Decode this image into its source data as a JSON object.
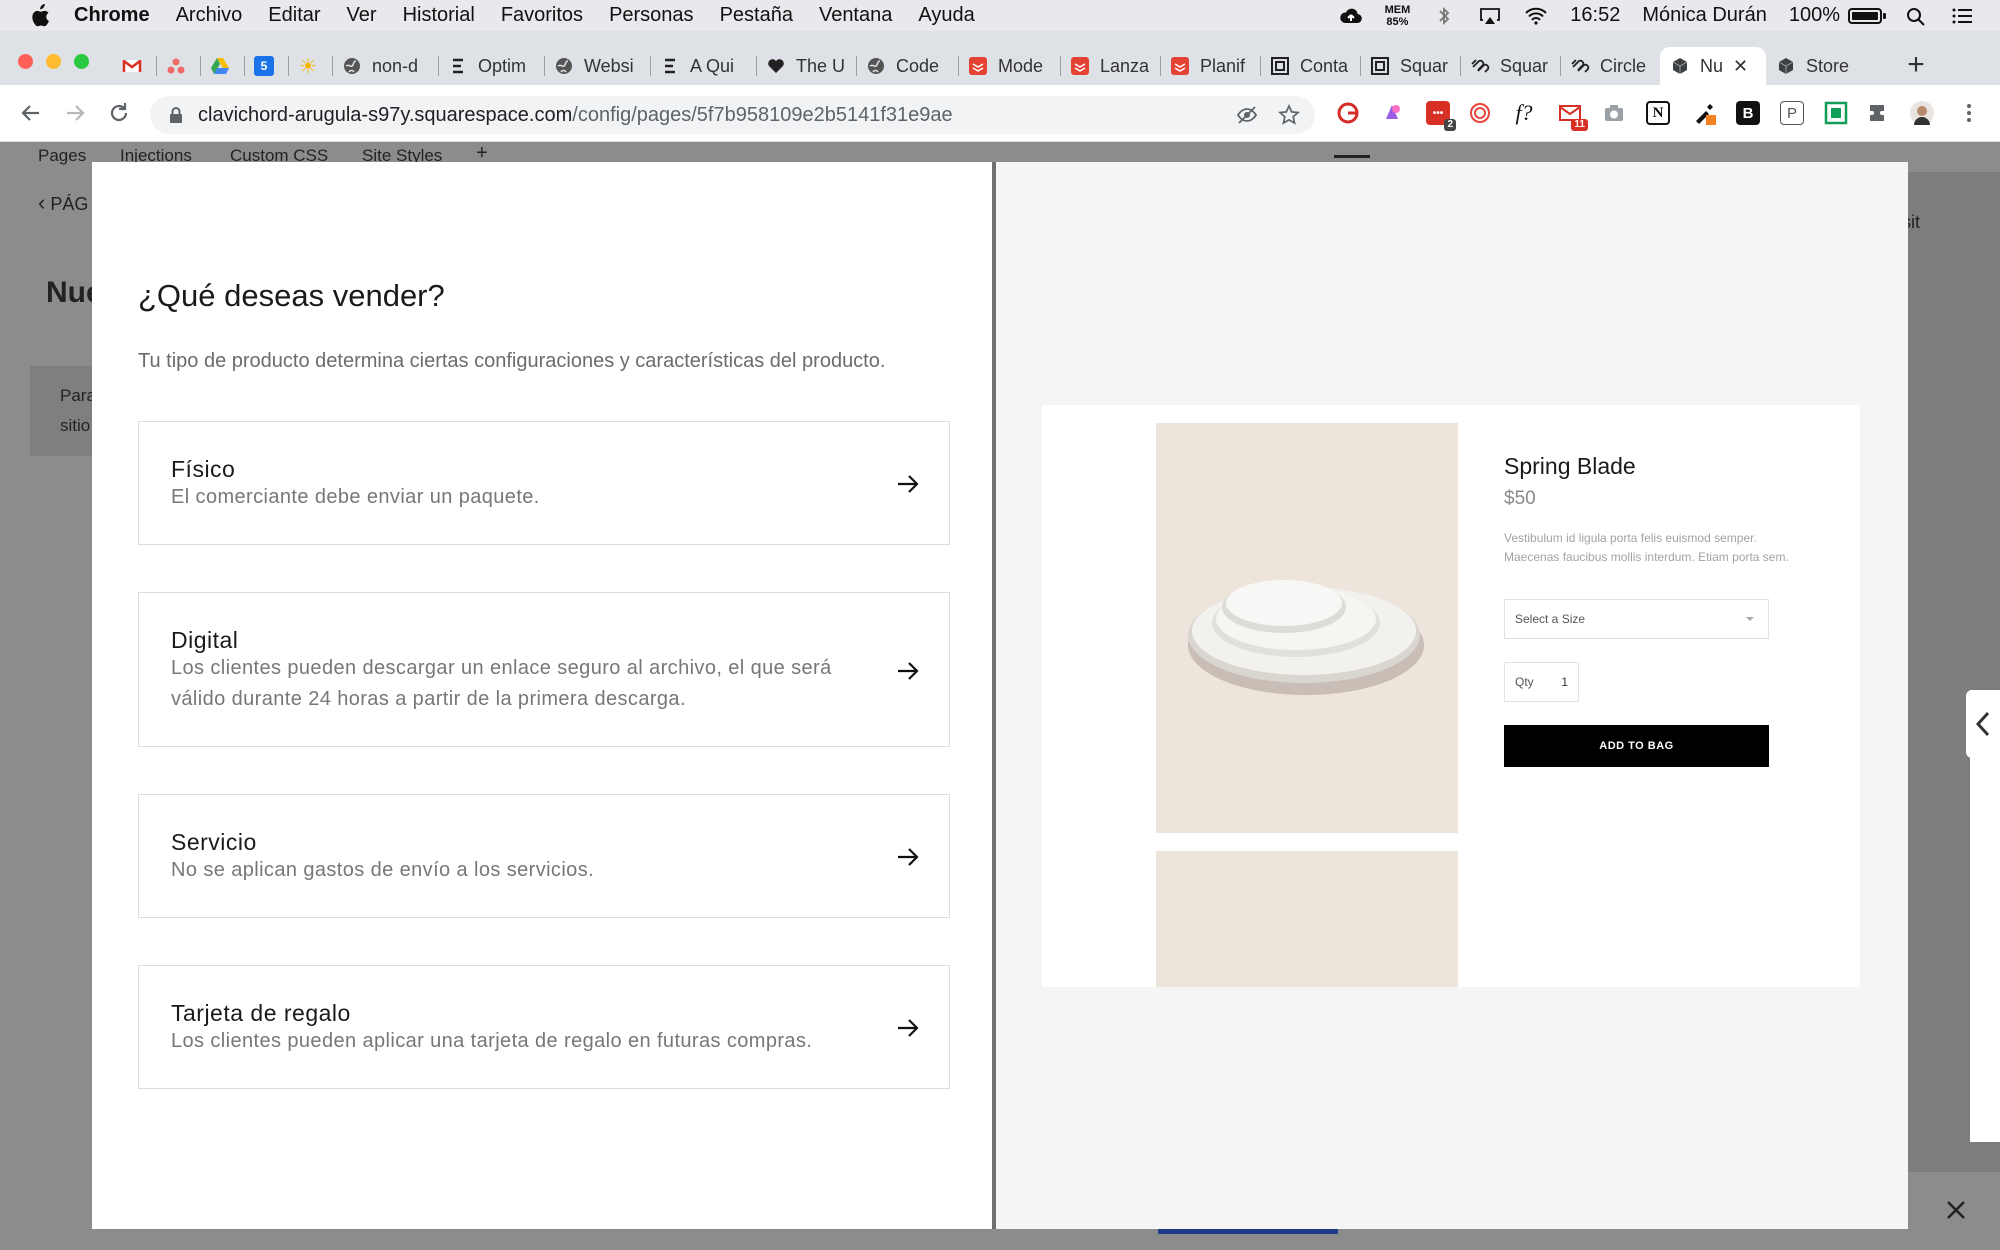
{
  "menubar": {
    "app": "Chrome",
    "items": [
      "Archivo",
      "Editar",
      "Ver",
      "Historial",
      "Favoritos",
      "Personas",
      "Pestaña",
      "Ventana",
      "Ayuda"
    ],
    "mem_label": "MEM",
    "mem_value": "85%",
    "time": "16:52",
    "user": "Mónica Durán",
    "battery": "100%"
  },
  "tabs": [
    {
      "title": "",
      "icon": "gmail-icon"
    },
    {
      "title": "",
      "icon": "asana-icon"
    },
    {
      "title": "",
      "icon": "drive-icon"
    },
    {
      "title": "",
      "icon": "calendar-icon"
    },
    {
      "title": "",
      "icon": "sun-icon"
    },
    {
      "title": "non-d",
      "icon": "globe-icon"
    },
    {
      "title": "Optim",
      "icon": "list-icon"
    },
    {
      "title": "Websi",
      "icon": "globe-icon"
    },
    {
      "title": "A Qui",
      "icon": "list-icon"
    },
    {
      "title": "The U",
      "icon": "heart-icon"
    },
    {
      "title": "Code",
      "icon": "globe-icon"
    },
    {
      "title": "Mode",
      "icon": "todoist-icon"
    },
    {
      "title": "Lanza",
      "icon": "todoist-icon"
    },
    {
      "title": "Planif",
      "icon": "todoist-icon"
    },
    {
      "title": "Conta",
      "icon": "frame-icon"
    },
    {
      "title": "Squar",
      "icon": "frame-icon"
    },
    {
      "title": "Squar",
      "icon": "squarespace-icon"
    },
    {
      "title": "Circle",
      "icon": "squarespace-icon"
    },
    {
      "title": "Nu",
      "icon": "box-icon",
      "active": true
    },
    {
      "title": "Store",
      "icon": "box-icon"
    }
  ],
  "address": {
    "host": "clavichord-arugula-s97y.squarespace.com",
    "path": "/config/pages/5f7b958109e2b5141f31e9ae"
  },
  "extensions": {
    "badge_1": "2",
    "badge_2": "11",
    "f_label": "f?",
    "n_label": "N",
    "b_label": "B",
    "p_label": "P"
  },
  "background": {
    "nav_pages": "Pages",
    "nav_injections": "Injections",
    "nav_css": "Custom CSS",
    "nav_styles": "Site Styles",
    "nav_add": "+",
    "back": "PÁG",
    "title": "Nue",
    "card_line1": "Para",
    "card_line2": "sitio",
    "visit": "sit"
  },
  "modal": {
    "heading": "¿Qué deseas vender?",
    "subtitle": "Tu tipo de producto determina ciertas configuraciones y características del producto.",
    "options": [
      {
        "title": "Físico",
        "description": "El comerciante debe enviar un paquete."
      },
      {
        "title": "Digital",
        "description": "Los clientes pueden descargar un enlace seguro al archivo, el que será válido durante 24 horas a partir de la primera descarga."
      },
      {
        "title": "Servicio",
        "description": "No se aplican gastos de envío a los servicios."
      },
      {
        "title": "Tarjeta de regalo",
        "description": "Los clientes pueden aplicar una tarjeta de regalo en futuras compras."
      }
    ]
  },
  "preview": {
    "name": "Spring Blade",
    "price": "$50",
    "description": "Vestibulum id ligula porta felis euismod semper. Maecenas faucibus mollis interdum. Etiam porta sem.",
    "size_placeholder": "Select a Size",
    "qty_label": "Qty",
    "qty_value": "1",
    "add_button": "ADD TO BAG"
  },
  "colors": {
    "menubar_bg": "#e9e8ec",
    "tabstrip_bg": "#dee1e6",
    "overlay_bg": "#8c8c8c",
    "product_bg": "#ede4dc",
    "button_bg": "#000000",
    "todoist_red": "#e44232"
  }
}
